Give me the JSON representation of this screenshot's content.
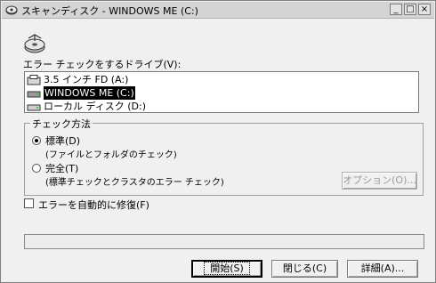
{
  "window": {
    "title": "スキャンディスク - WINDOWS ME (C:)",
    "controls": {
      "minimize": "_",
      "maximize": "□",
      "close": "×"
    }
  },
  "drive_select": {
    "label": "エラー チェックをするドライブ(V):",
    "items": [
      {
        "label": "3.5 インチ FD (A:)",
        "icon": "floppy-drive-icon",
        "selected": false
      },
      {
        "label": "WINDOWS ME (C:)",
        "icon": "hard-drive-icon",
        "selected": true
      },
      {
        "label": "ローカル ディスク (D:)",
        "icon": "hard-drive-icon",
        "selected": false
      }
    ]
  },
  "check_method": {
    "legend": "チェック方法",
    "options": [
      {
        "label": "標準(D)",
        "description": "(ファイルとフォルダのチェック)",
        "selected": true
      },
      {
        "label": "完全(T)",
        "description": "(標準チェックとクラスタのエラー チェック)",
        "selected": false
      }
    ],
    "options_button": "オプション(O)..."
  },
  "auto_fix": {
    "label": "エラーを自動的に修復(F)",
    "checked": false
  },
  "progress": {
    "value": 0
  },
  "buttons": {
    "start": "開始(S)",
    "close": "閉じる(C)",
    "details": "詳細(A)..."
  }
}
